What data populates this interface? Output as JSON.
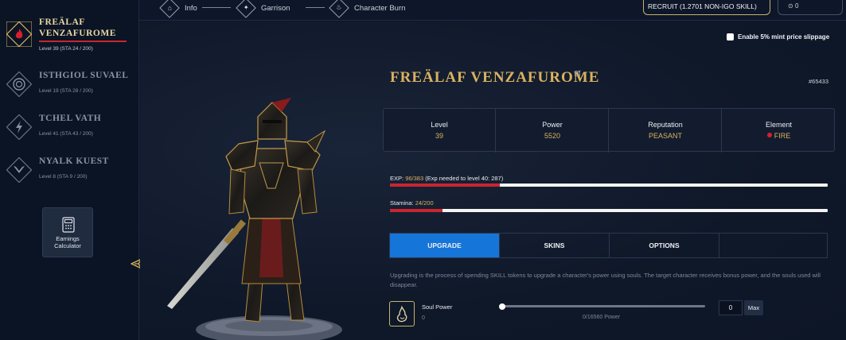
{
  "nav": {
    "items": [
      {
        "label": "Info",
        "icon": "house-icon"
      },
      {
        "label": "Garrison",
        "icon": "crosshair-icon"
      },
      {
        "label": "Character Burn",
        "icon": "flame-icon"
      }
    ],
    "recruit_label": "RECRUIT (1.2701 NON-IGO SKILL)",
    "wallet_value": "0"
  },
  "sidebar": {
    "characters": [
      {
        "name_line1": "FREÄLAF",
        "name_line2": "VENZAFUROME",
        "level_text": "Level 39 (STA 24 / 200)",
        "element": "fire",
        "active": true
      },
      {
        "name_line1": "ISTHGIOL SUVAEL",
        "name_line2": "",
        "level_text": "Level 19 (STA 28 / 200)",
        "element": "water",
        "active": false
      },
      {
        "name_line1": "TCHEL VATH",
        "name_line2": "",
        "level_text": "Level 41 (STA 43 / 200)",
        "element": "lightning",
        "active": false
      },
      {
        "name_line1": "NYALK KUEST",
        "name_line2": "",
        "level_text": "Level 8 (STA 9 / 200)",
        "element": "air",
        "active": false
      }
    ],
    "calculator": {
      "line1": "Earnings",
      "line2": "Calculator",
      "icon": "calculator-icon"
    }
  },
  "character": {
    "name": "FREÄLAF VENZAFUROME",
    "id": "#65433",
    "slippage_label": "Enable 5% mint price slippage",
    "stats": [
      {
        "label": "Level",
        "value": "39"
      },
      {
        "label": "Power",
        "value": "5520"
      },
      {
        "label": "Reputation",
        "value": "PEASANT"
      },
      {
        "label": "Element",
        "value": "FIRE"
      }
    ],
    "exp": {
      "label": "EXP:",
      "value": "96/383",
      "note": "(Exp needed to level 40: 287)",
      "fraction": 0.2507
    },
    "stamina": {
      "label": "Stamina:",
      "value": "24/200",
      "fraction": 0.12
    }
  },
  "tabs": [
    {
      "label": "UPGRADE",
      "active": true
    },
    {
      "label": "SKINS",
      "active": false
    },
    {
      "label": "OPTIONS",
      "active": false
    },
    {
      "label": "",
      "active": false
    }
  ],
  "upgrade": {
    "description": "Upgrading is the process of spending SKILL tokens to upgrade a character's power using souls. The target character receives bonus power, and the souls used will disappear.",
    "soul_label": "Soul Power",
    "soul_value": "0",
    "power_text": "0/16560 Power",
    "quantity": "0",
    "max_label": "Max",
    "slider_fraction": 0
  },
  "colors": {
    "accent_gold": "#d9b25f",
    "accent_red": "#c9262f",
    "active_tab_blue": "#1675d8",
    "background": "#0d1729"
  }
}
